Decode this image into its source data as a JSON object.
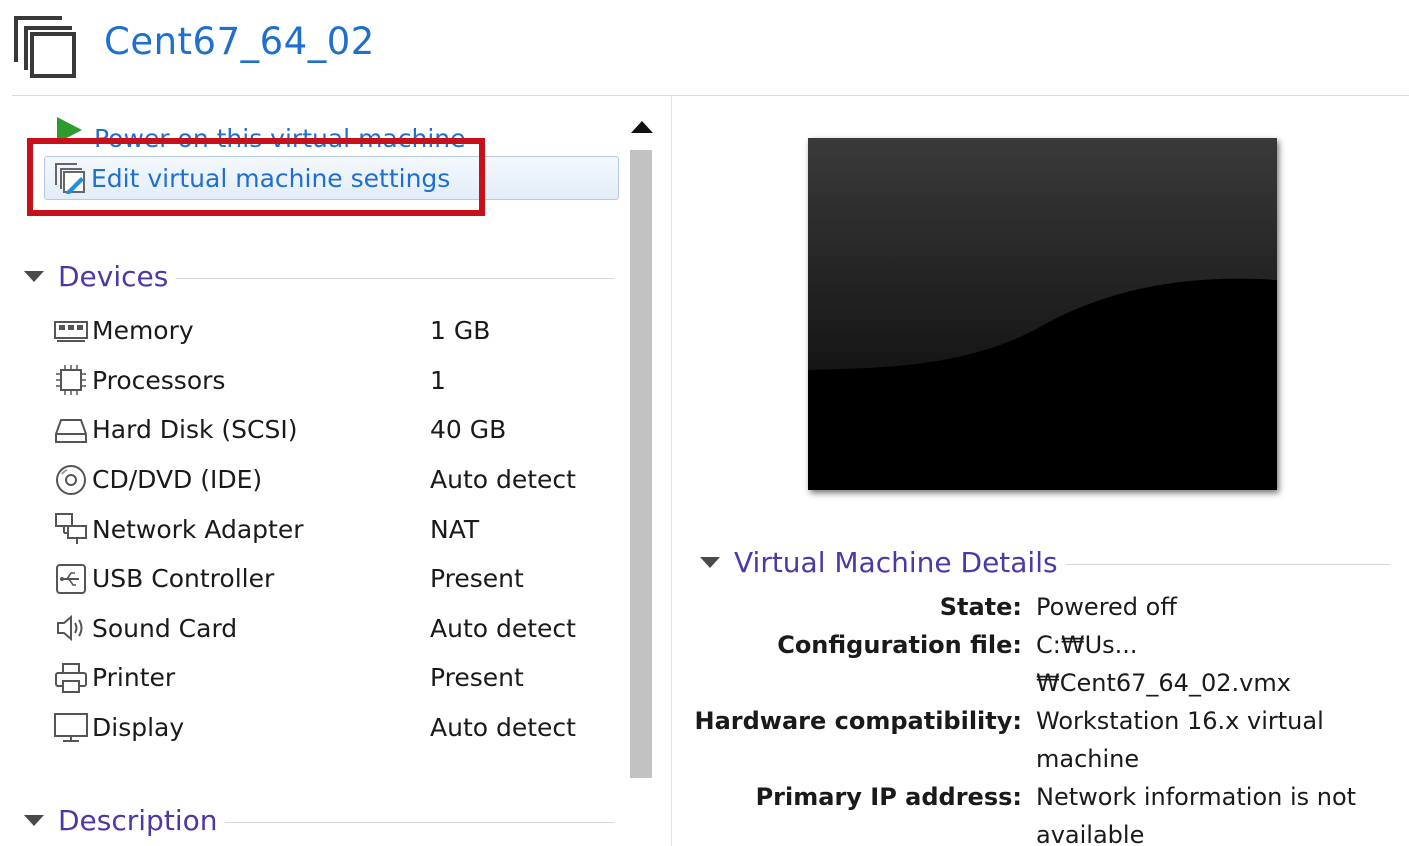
{
  "header": {
    "title": "Cent67_64_02",
    "icon": "vm-icon"
  },
  "commands": {
    "power_on": "Power on this virtual machine",
    "edit_settings": "Edit virtual machine settings"
  },
  "sections": {
    "devices": "Devices",
    "description": "Description",
    "details": "Virtual Machine Details"
  },
  "devices": [
    {
      "name": "Memory",
      "value": "1 GB",
      "icon": "memory-icon"
    },
    {
      "name": "Processors",
      "value": "1",
      "icon": "processor-icon"
    },
    {
      "name": "Hard Disk (SCSI)",
      "value": "40 GB",
      "icon": "hard-disk-icon"
    },
    {
      "name": "CD/DVD (IDE)",
      "value": "Auto detect",
      "icon": "cd-dvd-icon"
    },
    {
      "name": "Network Adapter",
      "value": "NAT",
      "icon": "network-adapter-icon"
    },
    {
      "name": "USB Controller",
      "value": "Present",
      "icon": "usb-icon"
    },
    {
      "name": "Sound Card",
      "value": "Auto detect",
      "icon": "speaker-icon"
    },
    {
      "name": "Printer",
      "value": "Present",
      "icon": "printer-icon"
    },
    {
      "name": "Display",
      "value": "Auto detect",
      "icon": "display-icon"
    }
  ],
  "details": [
    {
      "label": "State:",
      "value": "Powered off"
    },
    {
      "label": "Configuration file:",
      "value": "C:₩Us...₩Cent67_64_02.vmx"
    },
    {
      "label": "Hardware compatibility:",
      "value": "Workstation 16.x virtual machine"
    },
    {
      "label": "Primary IP address:",
      "value": "Network information is not available"
    }
  ],
  "colors": {
    "link": "#1f6fd0",
    "section": "#4a3aa8",
    "highlight": "#c8101a",
    "play": "#2e9b2e"
  }
}
